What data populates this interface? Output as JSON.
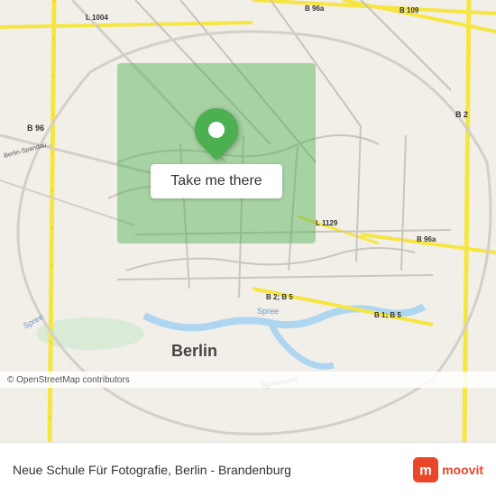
{
  "map": {
    "attribution": "© OpenStreetMap contributors",
    "highlight_color": "#4CAF50",
    "pin_color": "#4CAF50"
  },
  "button": {
    "label": "Take me there"
  },
  "bottom_bar": {
    "location_name": "Neue Schule Für Fotografie, Berlin - Brandenburg"
  },
  "moovit": {
    "name": "moovit",
    "icon_color": "#e8472a"
  }
}
